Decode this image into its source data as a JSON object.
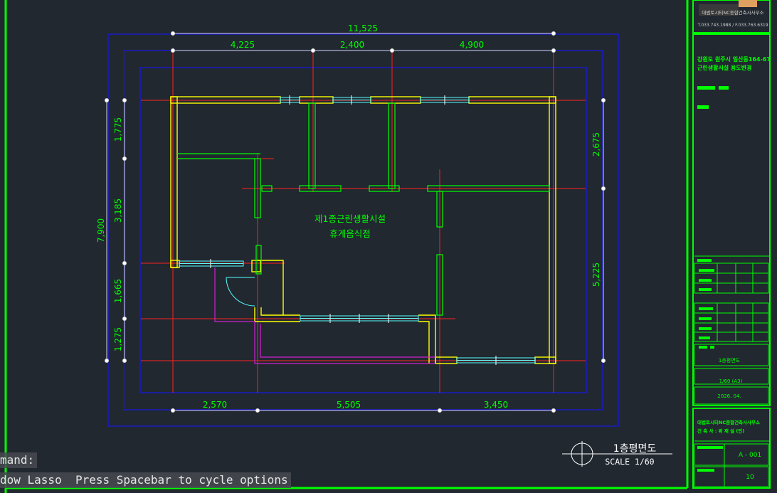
{
  "drawing": {
    "overall_width": "11,525",
    "top_dims": [
      "4,225",
      "2,400",
      "4,900"
    ],
    "bottom_dims": [
      "2,570",
      "5,505",
      "3,450"
    ],
    "left_overall": "7,900",
    "left_dims": [
      "1,775",
      "3,185",
      "1,665",
      "1,275"
    ],
    "right_dims": [
      "2,675",
      "5,225"
    ],
    "room_label_1": "제1종근린생활시설",
    "room_label_2": "휴게음식점",
    "view_title": "1층평면도",
    "scale": "SCALE  1/60"
  },
  "title_block": {
    "logo_text_1": "대법토시티NC종합건축사사무소",
    "logo_text_2": "T.033.743.1988 / F.033.763.6319",
    "address": "강원도 원주시 일산동164-67",
    "project": "근린생활시설 용도변경",
    "sheet_name": "1층평면도",
    "sheet_scale": "1/60 (A3)",
    "date": "2026. 04.",
    "office": "대법토시티NC종합건축사사무소",
    "architect": "건 축 사 : 위  재  설  (인)",
    "sheet_no": "A - 001",
    "page_no": "10"
  },
  "command": {
    "label": "mand:",
    "prompt": "dow Lasso  Press Spacebar to cycle options"
  },
  "colors": {
    "background": "#212830",
    "wall": "#ffff00",
    "wall_inner": "#00ff00",
    "grid": "#ff2020",
    "window": "#55ffff",
    "dimension": "#00ff00",
    "frame": "#1010ff",
    "door_swing": "#d020d0"
  }
}
